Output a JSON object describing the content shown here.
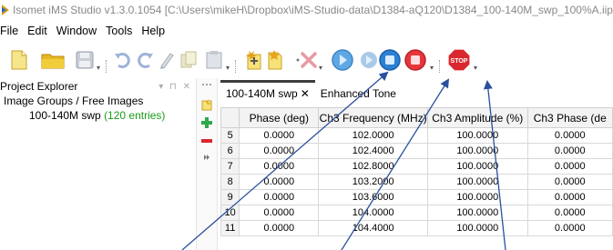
{
  "window": {
    "title": "Isomet iMS Studio v1.3.0.1054 [C:\\Users\\mikeH\\Dropbox\\iMS-Studio-data\\D1384-aQ120\\D1384_100-140M_swp_100%A.iip]"
  },
  "menu": [
    "File",
    "Edit",
    "Window",
    "Tools",
    "Help"
  ],
  "explorer": {
    "title": "Project Explorer",
    "pin": "▾ ⊓ ✕",
    "group": "Image Groups / Free Images",
    "item_name": "100-140M swp",
    "item_count": "(120 entries)"
  },
  "tabs": [
    {
      "label": "100-140M swp",
      "close": "✕"
    },
    {
      "label": "Enhanced Tone"
    }
  ],
  "table": {
    "columns": [
      "Phase (deg)",
      "Ch3 Frequency (MHz)",
      "Ch3 Amplitude (%)",
      "Ch3 Phase (de"
    ],
    "rows": [
      {
        "n": "5",
        "cells": [
          "0.0000",
          "102.0000",
          "100.0000",
          "0.0000"
        ]
      },
      {
        "n": "6",
        "cells": [
          "0.0000",
          "102.4000",
          "100.0000",
          "0.0000"
        ]
      },
      {
        "n": "7",
        "cells": [
          "0.0000",
          "102.8000",
          "100.0000",
          "0.0000"
        ]
      },
      {
        "n": "8",
        "cells": [
          "0.0000",
          "103.2000",
          "100.0000",
          "0.0000"
        ]
      },
      {
        "n": "9",
        "cells": [
          "0.0000",
          "103.6000",
          "100.0000",
          "0.0000"
        ]
      },
      {
        "n": "10",
        "cells": [
          "0.0000",
          "104.0000",
          "100.0000",
          "0.0000"
        ]
      },
      {
        "n": "11",
        "cells": [
          "0.0000",
          "104.4000",
          "100.0000",
          "0.0000"
        ]
      }
    ]
  },
  "toolbar": {
    "icons": [
      "new-file-icon",
      "open-folder-icon",
      "save-icon",
      "undo-icon",
      "redo-icon",
      "edit-icon",
      "copy-icon",
      "paste-icon",
      "new-image-icon",
      "add-icon",
      "delete-icon",
      "play-icon",
      "play-outline-icon",
      "stop-blue-icon",
      "stop-red-icon",
      "stop-sign-icon"
    ],
    "stop_text": "STOP"
  },
  "colors": {
    "accent_blue": "#1e7fd6",
    "stop_red": "#d9272e",
    "annotation": "#2a4f9c"
  }
}
